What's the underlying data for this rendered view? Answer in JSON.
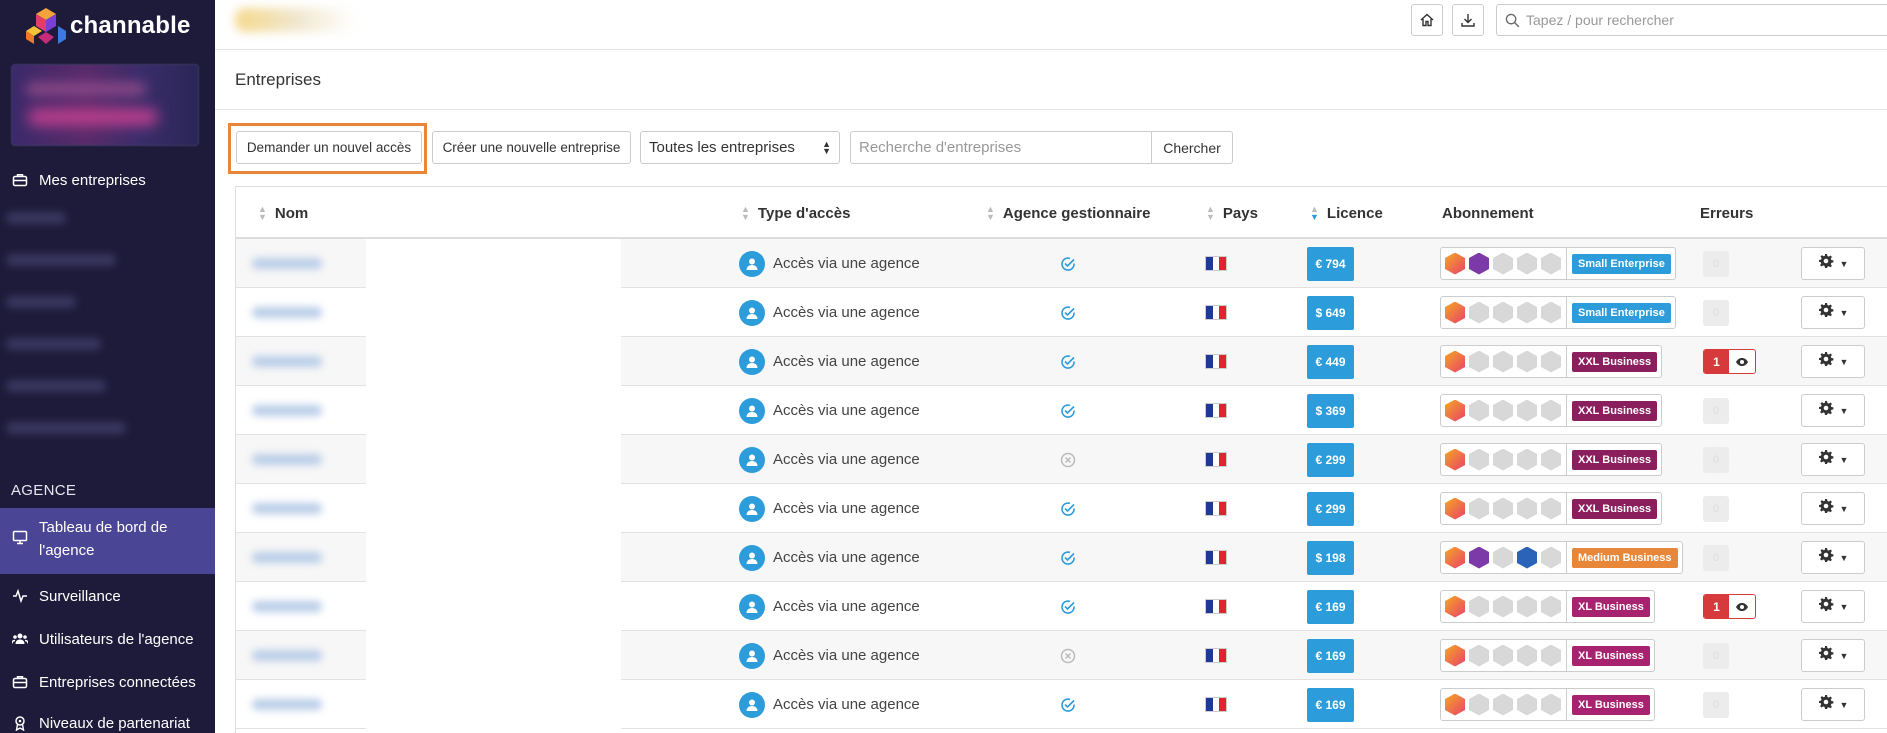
{
  "app": {
    "name": "channable"
  },
  "sidebar": {
    "my_companies": "Mes entreprises",
    "section_label": "AGENCE",
    "items": [
      {
        "label": "Tableau de bord de l'agence",
        "icon": "monitor-icon"
      },
      {
        "label": "Surveillance",
        "icon": "activity-icon"
      },
      {
        "label": "Utilisateurs de l'agence",
        "icon": "users-icon"
      },
      {
        "label": "Entreprises connectées",
        "icon": "briefcase-icon"
      },
      {
        "label": "Niveaux de partenariat",
        "icon": "award-icon"
      }
    ]
  },
  "topbar": {
    "search_placeholder": "Tapez / pour rechercher"
  },
  "page": {
    "title": "Entreprises"
  },
  "toolbar": {
    "request_access": "Demander un nouvel accès",
    "create_company": "Créer une nouvelle entreprise",
    "filter_selected": "Toutes les entreprises",
    "search_placeholder": "Recherche d'entreprises",
    "search_button": "Chercher"
  },
  "table": {
    "headers": {
      "nom": "Nom",
      "type": "Type d'accès",
      "agence": "Agence gestionnaire",
      "pays": "Pays",
      "licence": "Licence",
      "abonnement": "Abonnement",
      "erreurs": "Erreurs"
    },
    "rows": [
      {
        "type": "Accès via une agence",
        "managed": true,
        "licence": "€ 794",
        "plan": "Small Enterprise",
        "plan_color": "#2d9cdb",
        "mods": [
          "on",
          "purple",
          "off",
          "off",
          "off"
        ],
        "errors": "0"
      },
      {
        "type": "Accès via une agence",
        "managed": true,
        "licence": "$ 649",
        "plan": "Small Enterprise",
        "plan_color": "#2d9cdb",
        "mods": [
          "on",
          "off",
          "off",
          "off",
          "off"
        ],
        "errors": "0"
      },
      {
        "type": "Accès via une agence",
        "managed": true,
        "licence": "€ 449",
        "plan": "XXL Business",
        "plan_color": "#8b1e5c",
        "mods": [
          "on",
          "off",
          "off",
          "off",
          "off"
        ],
        "errors": "1"
      },
      {
        "type": "Accès via une agence",
        "managed": true,
        "licence": "$ 369",
        "plan": "XXL Business",
        "plan_color": "#8b1e5c",
        "mods": [
          "on",
          "off",
          "off",
          "off",
          "off"
        ],
        "errors": "0"
      },
      {
        "type": "Accès via une agence",
        "managed": false,
        "licence": "€ 299",
        "plan": "XXL Business",
        "plan_color": "#8b1e5c",
        "mods": [
          "on",
          "off",
          "off",
          "off",
          "off"
        ],
        "errors": "0"
      },
      {
        "type": "Accès via une agence",
        "managed": true,
        "licence": "€ 299",
        "plan": "XXL Business",
        "plan_color": "#8b1e5c",
        "mods": [
          "on",
          "off",
          "off",
          "off",
          "off"
        ],
        "errors": "0"
      },
      {
        "type": "Accès via une agence",
        "managed": true,
        "licence": "$ 198",
        "plan": "Medium Business",
        "plan_color": "#e8873a",
        "mods": [
          "on",
          "purple",
          "off",
          "blue",
          "off"
        ],
        "errors": "0"
      },
      {
        "type": "Accès via une agence",
        "managed": true,
        "licence": "€ 169",
        "plan": "XL Business",
        "plan_color": "#a8236f",
        "mods": [
          "on",
          "off",
          "off",
          "off",
          "off"
        ],
        "errors": "1"
      },
      {
        "type": "Accès via une agence",
        "managed": false,
        "licence": "€ 169",
        "plan": "XL Business",
        "plan_color": "#a8236f",
        "mods": [
          "on",
          "off",
          "off",
          "off",
          "off"
        ],
        "errors": "0"
      },
      {
        "type": "Accès via une agence",
        "managed": true,
        "licence": "€ 169",
        "plan": "XL Business",
        "plan_color": "#a8236f",
        "mods": [
          "on",
          "off",
          "off",
          "off",
          "off"
        ],
        "errors": "0"
      }
    ]
  },
  "colors": {
    "sidebar_bg": "#1e1b3a",
    "sidebar_active": "#4a4594",
    "accent_blue": "#2d9cdb",
    "highlight_orange": "#e8873a",
    "error_red": "#d73a3a"
  }
}
